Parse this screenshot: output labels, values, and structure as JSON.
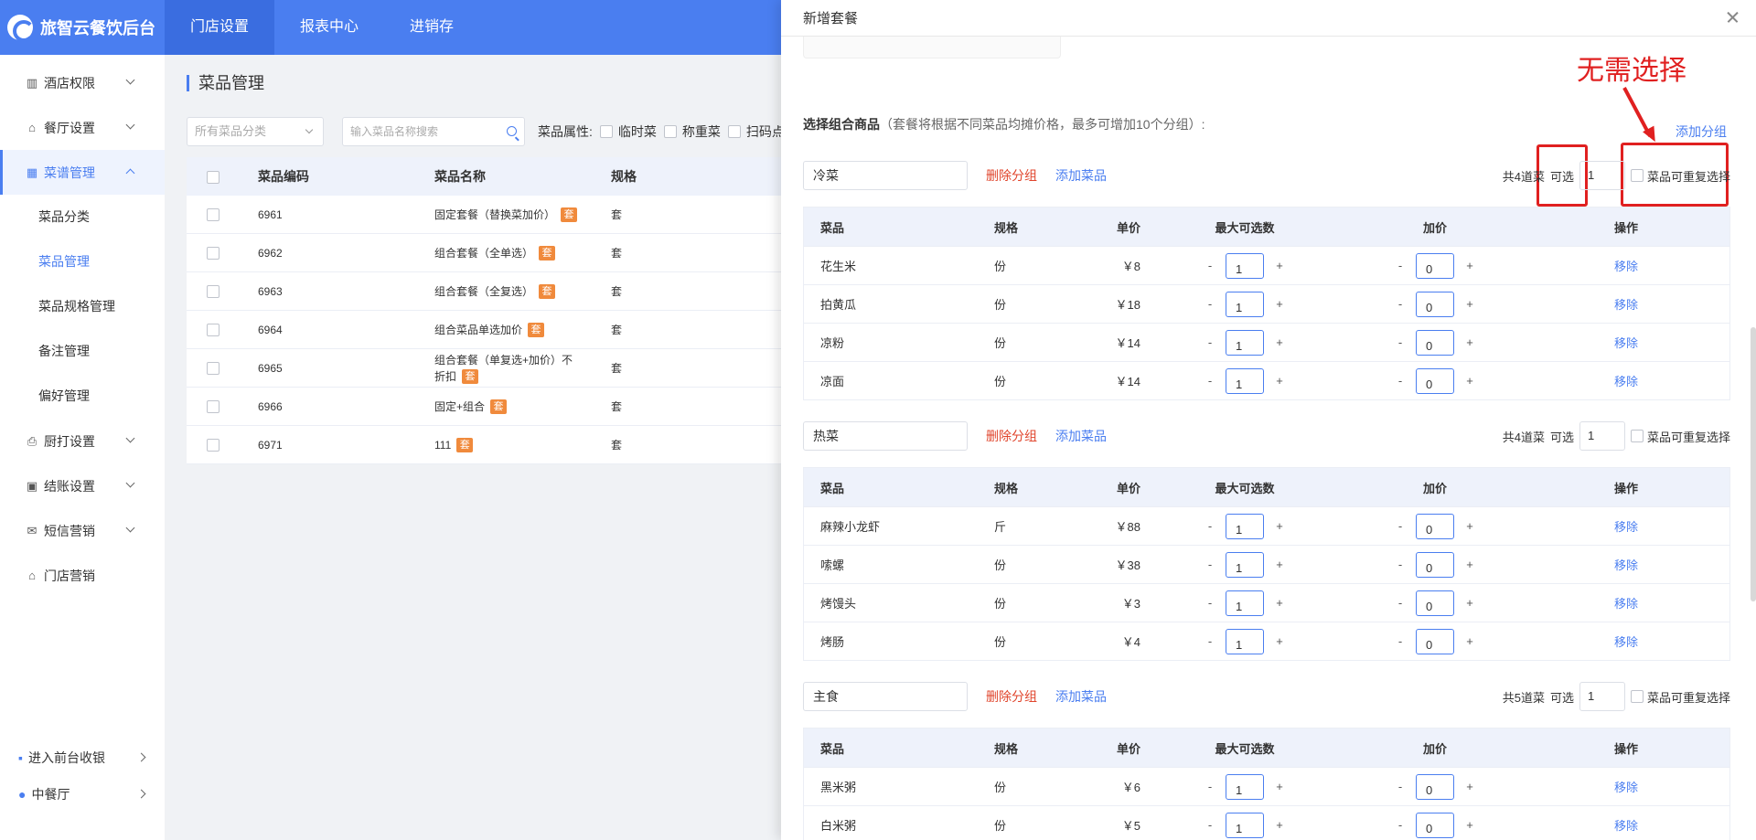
{
  "app": {
    "brand": "旅智云餐饮后台"
  },
  "top_nav": [
    {
      "label": "门店设置"
    },
    {
      "label": "报表中心"
    },
    {
      "label": "进销存"
    }
  ],
  "sidebar": {
    "items": [
      {
        "label": "酒店权限",
        "icon": "hotel-icon"
      },
      {
        "label": "餐厅设置",
        "icon": "restaurant-icon"
      },
      {
        "label": "菜谱管理",
        "icon": "grid-icon"
      },
      {
        "label": "厨打设置",
        "icon": "printer-icon"
      },
      {
        "label": "结账设置",
        "icon": "checkout-icon"
      },
      {
        "label": "短信营销",
        "icon": "mail-icon"
      },
      {
        "label": "门店营销",
        "icon": "store-icon"
      }
    ],
    "sub_items": [
      {
        "label": "菜品分类"
      },
      {
        "label": "菜品管理"
      },
      {
        "label": "菜品规格管理"
      },
      {
        "label": "备注管理"
      },
      {
        "label": "偏好管理"
      }
    ],
    "bottom": [
      {
        "label": "进入前台收银"
      },
      {
        "label": "中餐厅"
      }
    ]
  },
  "main": {
    "title": "菜品管理",
    "filters": {
      "category_placeholder": "所有菜品分类",
      "search_placeholder": "输入菜品名称搜索",
      "attr_label": "菜品属性:",
      "attr_options": [
        "临时菜",
        "称重菜",
        "扫码点"
      ]
    },
    "table": {
      "headers": [
        "菜品编码",
        "菜品名称",
        "规格"
      ],
      "badge": "套",
      "rows": [
        {
          "code": "6961",
          "name": "固定套餐（替换菜加价）",
          "spec": "套"
        },
        {
          "code": "6962",
          "name": "组合套餐（全单选）",
          "spec": "套"
        },
        {
          "code": "6963",
          "name": "组合套餐（全复选）",
          "spec": "套"
        },
        {
          "code": "6964",
          "name": "组合菜品单选加价",
          "spec": "套"
        },
        {
          "code": "6965",
          "name": "组合套餐（单复选+加价）不折扣",
          "spec": "套"
        },
        {
          "code": "6966",
          "name": "固定+组合",
          "spec": "套"
        },
        {
          "code": "6971",
          "name": "111",
          "spec": "套"
        }
      ]
    }
  },
  "drawer": {
    "title": "新增套餐",
    "section_label": "选择组合商品",
    "section_hint": "（套餐将根据不同菜品均摊价格，最多可增加10个分组）:",
    "add_group": "添加分组",
    "annotation": "无需选择",
    "delete_group": "删除分组",
    "add_dish": "添加菜品",
    "optional_label": "可选",
    "repeat_label": "菜品可重复选择",
    "columns": [
      "菜品",
      "规格",
      "单价",
      "最大可选数",
      "加价",
      "操作"
    ],
    "remove_label": "移除",
    "minus": "-",
    "plus": "+",
    "groups": [
      {
        "name": "冷菜",
        "count_text": "共4道菜",
        "optional": "1",
        "items": [
          {
            "name": "花生米",
            "spec": "份",
            "price": "￥8",
            "max": "1",
            "extra": "0"
          },
          {
            "name": "拍黄瓜",
            "spec": "份",
            "price": "￥18",
            "max": "1",
            "extra": "0"
          },
          {
            "name": "凉粉",
            "spec": "份",
            "price": "￥14",
            "max": "1",
            "extra": "0"
          },
          {
            "name": "凉面",
            "spec": "份",
            "price": "￥14",
            "max": "1",
            "extra": "0"
          }
        ]
      },
      {
        "name": "热菜",
        "count_text": "共4道菜",
        "optional": "1",
        "items": [
          {
            "name": "麻辣小龙虾",
            "spec": "斤",
            "price": "￥88",
            "max": "1",
            "extra": "0"
          },
          {
            "name": "嗦螺",
            "spec": "份",
            "price": "￥38",
            "max": "1",
            "extra": "0"
          },
          {
            "name": "烤馒头",
            "spec": "份",
            "price": "￥3",
            "max": "1",
            "extra": "0"
          },
          {
            "name": "烤肠",
            "spec": "份",
            "price": "￥4",
            "max": "1",
            "extra": "0"
          }
        ]
      },
      {
        "name": "主食",
        "count_text": "共5道菜",
        "optional": "1",
        "items": [
          {
            "name": "黑米粥",
            "spec": "份",
            "price": "￥6",
            "max": "1",
            "extra": "0"
          },
          {
            "name": "白米粥",
            "spec": "份",
            "price": "￥5",
            "max": "1",
            "extra": "0"
          }
        ]
      }
    ]
  },
  "colors": {
    "primary": "#4a7ef0",
    "danger": "#e0452c",
    "annotation": "#e02020",
    "badge": "#f08a3c"
  }
}
